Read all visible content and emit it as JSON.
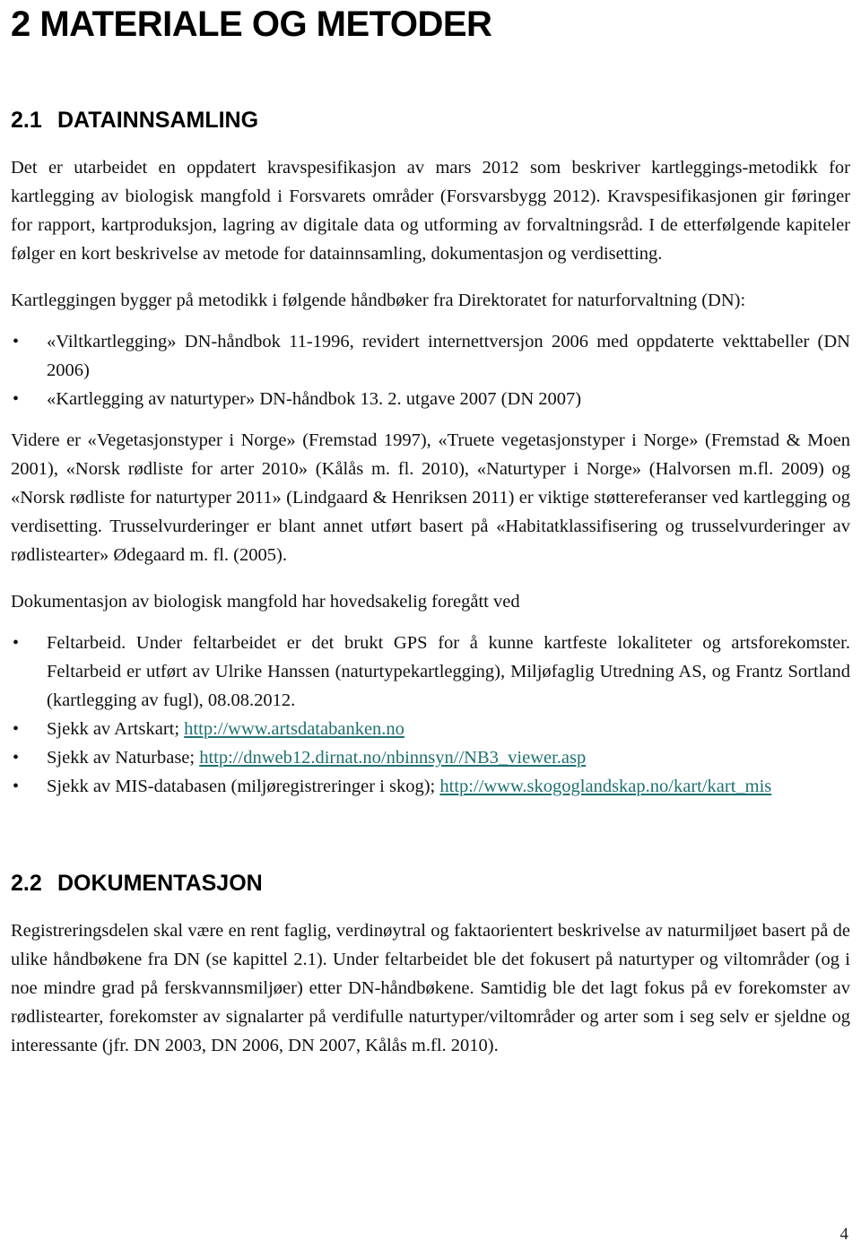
{
  "document": {
    "chapter_heading": "2 MATERIALE OG METODER",
    "page_number": "4",
    "link_color": "#1f7070"
  },
  "sections": [
    {
      "number": "2.1",
      "title": "DATAINNSAMLING",
      "paragraphs": {
        "intro": "Det er utarbeidet en oppdatert kravspesifikasjon av mars 2012 som beskriver kartleggings-metodikk for kartlegging av biologisk mangfold i Forsvarets områder (Forsvarsbygg 2012). Kravspesifikasjonen gir føringer for rapport, kartproduksjon, lagring av digitale data og utforming av forvaltningsråd. I de etterfølgende kapiteler følger en kort beskrivelse av metode for datainnsamling, dokumentasjon og verdisetting.",
        "handbooks_lead": "Kartleggingen bygger på metodikk i følgende håndbøker fra Direktoratet for naturforvaltning (DN):",
        "references": "Videre er «Vegetasjonstyper i Norge» (Fremstad 1997), «Truete vegetasjonstyper i Norge» (Fremstad & Moen 2001), «Norsk rødliste for arter 2010» (Kålås m. fl. 2010), «Naturtyper i Norge» (Halvorsen m.fl. 2009) og «Norsk rødliste for naturtyper 2011» (Lindgaard & Henriksen 2011) er viktige støttereferanser ved kartlegging og verdisetting. Trusselvurderinger er blant annet utført basert på «Habitatklassifisering og trusselvurderinger av rødlistearter» Ødegaard m. fl. (2005).",
        "documentation_lead": "Dokumentasjon av biologisk mangfold har hovedsakelig foregått ved"
      },
      "handbook_bullets": [
        "«Viltkartlegging» DN-håndbok 11-1996, revidert internettversjon 2006 med oppdaterte vekttabeller (DN 2006)",
        "«Kartlegging av naturtyper» DN-håndbok 13. 2. utgave 2007 (DN 2007)"
      ],
      "documentation_bullets": [
        {
          "text": "Feltarbeid. Under feltarbeidet er det brukt GPS for å kunne kartfeste lokaliteter og artsforekomster. Feltarbeid er utført av Ulrike Hanssen (naturtypekartlegging), Miljøfaglig Utredning AS, og Frantz Sortland (kartlegging av fugl), 08.08.2012.",
          "link": ""
        },
        {
          "text": "Sjekk av Artskart; ",
          "link": "http://www.artsdatabanken.no"
        },
        {
          "text": "Sjekk av Naturbase; ",
          "link": "http://dnweb12.dirnat.no/nbinnsyn//NB3_viewer.asp"
        },
        {
          "text": "Sjekk av MIS-databasen (miljøregistreringer i skog); ",
          "link": "http://www.skogoglandskap.no/kart/kart_mis"
        }
      ]
    },
    {
      "number": "2.2",
      "title": "DOKUMENTASJON",
      "paragraphs": {
        "body": "Registreringsdelen skal være en rent faglig, verdinøytral og faktaorientert beskrivelse av naturmiljøet basert på de ulike håndbøkene fra DN (se kapittel 2.1). Under feltarbeidet ble det fokusert på naturtyper og viltområder (og i noe mindre grad på ferskvannsmiljøer) etter DN-håndbøkene. Samtidig ble det lagt fokus på ev forekomster av rødlistearter, forekomster av signalarter på verdifulle naturtyper/viltområder og arter som i seg selv er sjeldne og interessante (jfr. DN 2003, DN 2006, DN 2007, Kålås m.fl. 2010)."
      }
    }
  ]
}
